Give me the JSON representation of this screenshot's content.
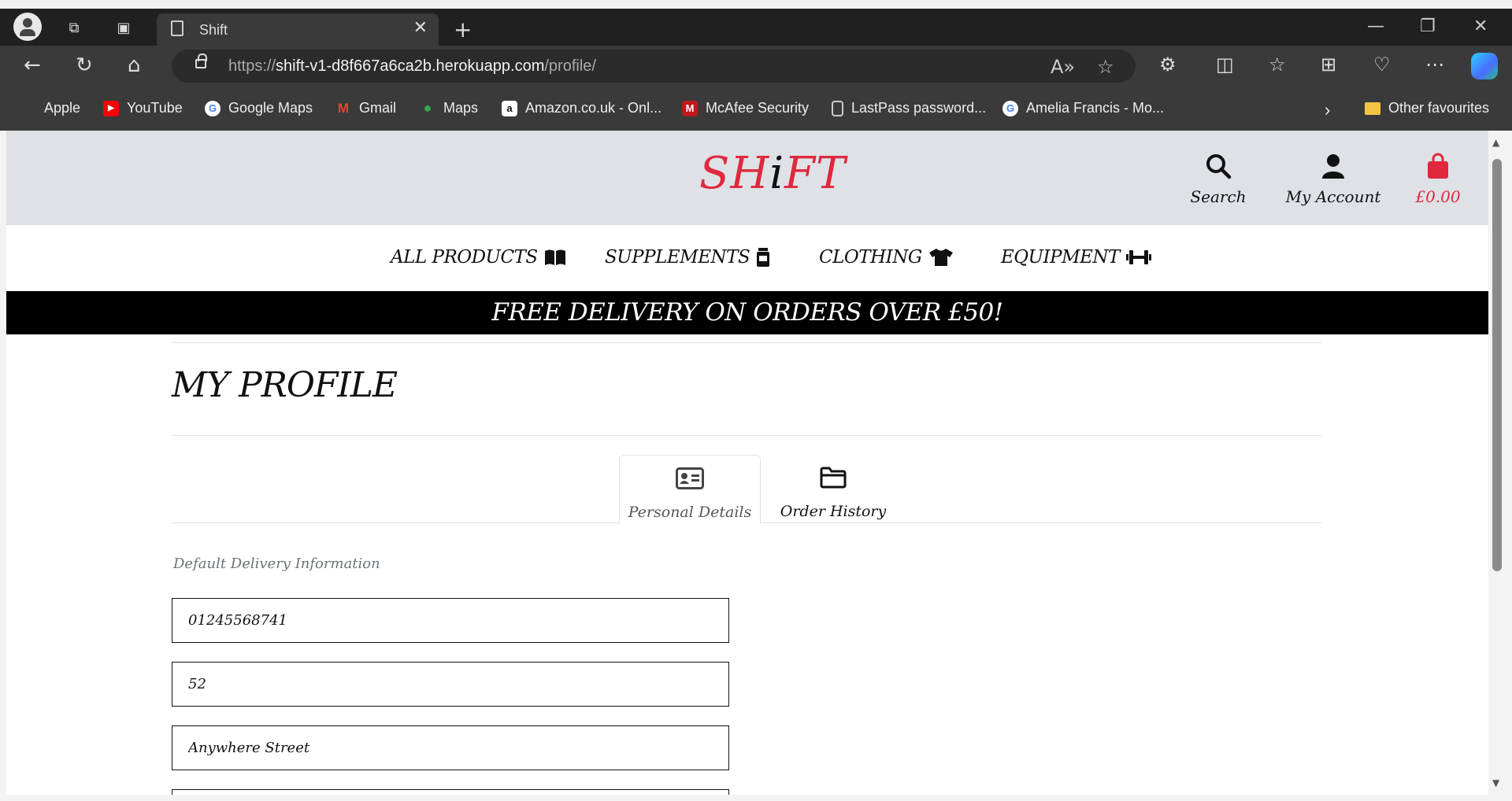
{
  "browser": {
    "tab_title": "Shift",
    "url_prefix": "https://",
    "url_host": "shift-v1-d8f667a6ca2b.herokuapp.com",
    "url_path": "/profile/",
    "bookmarks": [
      {
        "label": "Apple",
        "icon": "apple-icon",
        "color": "#9a9a9a"
      },
      {
        "label": "YouTube",
        "icon": "youtube-icon",
        "color": "#ff0000"
      },
      {
        "label": "Google Maps",
        "icon": "google-icon",
        "color": "#4285f4"
      },
      {
        "label": "Gmail",
        "icon": "gmail-icon",
        "color": "#ea4335"
      },
      {
        "label": "Maps",
        "icon": "maps-pin-icon",
        "color": "#34a853"
      },
      {
        "label": "Amazon.co.uk - Onl...",
        "icon": "amazon-icon",
        "color": "#ffffff"
      },
      {
        "label": "McAfee Security",
        "icon": "mcafee-icon",
        "color": "#c01818"
      },
      {
        "label": "LastPass password...",
        "icon": "page-icon",
        "color": "#3a3a3a"
      },
      {
        "label": "Amelia Francis - Mo...",
        "icon": "google-icon",
        "color": "#4285f4"
      }
    ],
    "other_favourites": "Other favourites"
  },
  "site": {
    "logo_pre": "SH",
    "logo_i": "i",
    "logo_post": "FT",
    "search_label": "Search",
    "account_label": "My Account",
    "bag_total": "£0.00",
    "brand_color": "#e0283e",
    "nav": {
      "all_products": "ALL PRODUCTS",
      "supplements": "SUPPLEMENTS",
      "clothing": "CLOTHING",
      "equipment": "EQUIPMENT"
    },
    "banner": "FREE DELIVERY ON ORDERS OVER £50!"
  },
  "profile": {
    "title": "MY PROFILE",
    "tabs": {
      "personal": "Personal Details",
      "orders": "Order History"
    },
    "section_label": "Default Delivery Information",
    "fields": {
      "phone": "01245568741",
      "house": "52",
      "street": "Anywhere Street"
    }
  }
}
